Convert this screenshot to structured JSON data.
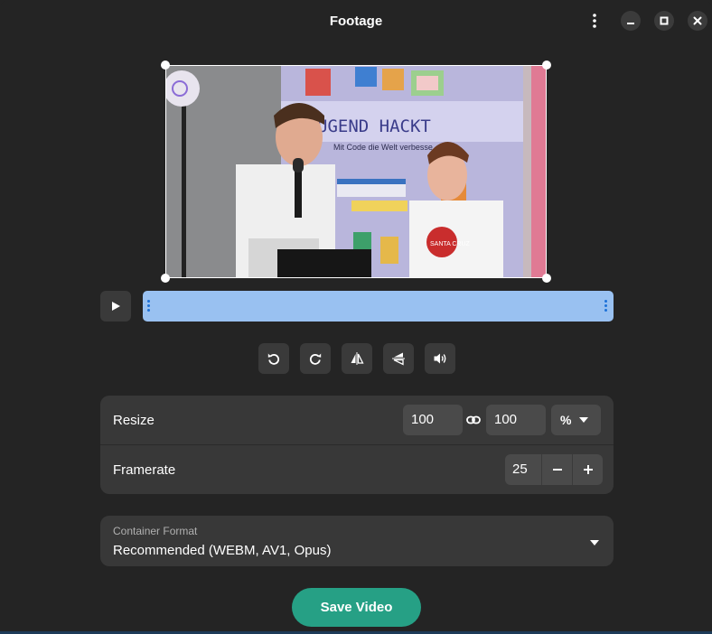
{
  "window": {
    "title": "Footage"
  },
  "timeline": {
    "trim_start": 0.0,
    "trim_end": 1.0
  },
  "resize": {
    "label": "Resize",
    "width": "100",
    "height": "100",
    "unit": "%"
  },
  "framerate": {
    "label": "Framerate",
    "value": "25"
  },
  "container": {
    "label": "Container Format",
    "value": "Recommended (WEBM, AV1, Opus)"
  },
  "actions": {
    "save_label": "Save Video"
  },
  "colors": {
    "accent": "#26a085",
    "timeline": "#99c1f1",
    "timeline_handle": "#1c71d8",
    "background": "#242424",
    "card": "#383838"
  },
  "video_overlay_text": {
    "banner": "UGEND HACKT",
    "banner_sub": "Mit Code die Welt verbesse",
    "shirt": "SANTA CRUZ"
  },
  "icons": {
    "menu": "vertical-dots-icon",
    "minimize": "minimize-icon",
    "maximize": "maximize-icon",
    "close": "close-icon",
    "play": "play-icon",
    "rotate_left": "rotate-left-icon",
    "rotate_right": "rotate-right-icon",
    "flip_horizontal": "flip-horizontal-icon",
    "flip_vertical": "flip-vertical-icon",
    "volume": "volume-icon",
    "link": "link-icon",
    "dropdown": "chevron-down-icon"
  }
}
